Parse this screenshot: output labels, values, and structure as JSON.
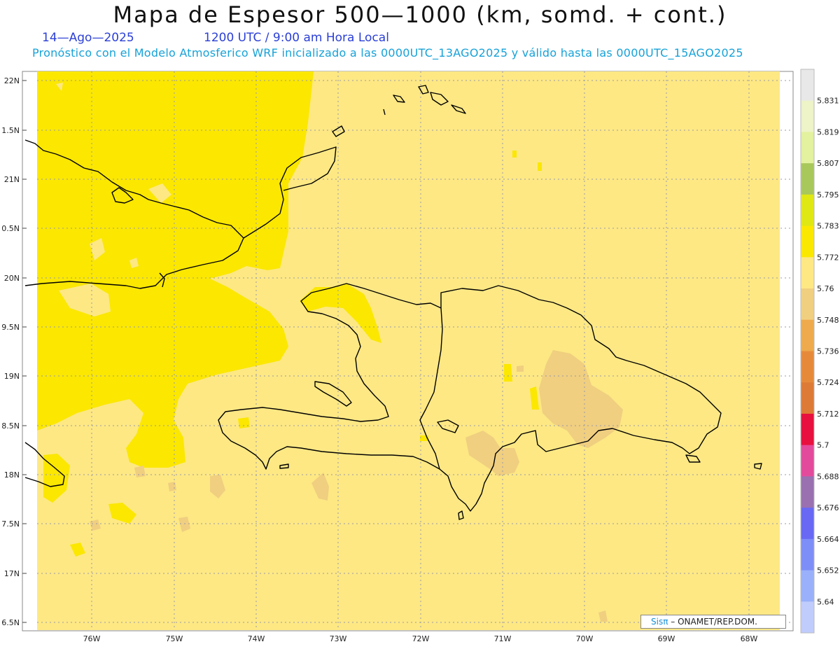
{
  "header": {
    "title": "Mapa de Espesor 500—1000 (km, somd. + cont.)",
    "date": "14—Ago—2025",
    "time": "1200 UTC / 9:00 am Hora Local",
    "forecast_note": "Pronóstico con el Modelo Atmosferico WRF inicializado a las 0000UTC_13AGO2025 y válido hasta las  0000UTC_15AGO2025"
  },
  "map": {
    "lat_labels": [
      "22N",
      "1.5N",
      "21N",
      "0.5N",
      "20N",
      "9.5N",
      "19N",
      "8.5N",
      "18N",
      "7.5N",
      "17N",
      "6.5N"
    ],
    "lon_labels": [
      "76W",
      "75W",
      "74W",
      "73W",
      "72W",
      "71W",
      "70W",
      "69W",
      "68W"
    ],
    "field_colors": {
      "dominant": "#fde884",
      "higher": "#fbe700",
      "lower": "#f0cf80",
      "coast": "#000000",
      "grid": "#9a9aa8"
    }
  },
  "colorbar": {
    "labels": [
      "5.831",
      "5.819",
      "5.807",
      "5.795",
      "5.783",
      "5.772",
      "5.76",
      "5.748",
      "5.736",
      "5.724",
      "5.712",
      "5.7",
      "5.688",
      "5.676",
      "5.664",
      "5.652",
      "5.64"
    ],
    "colors": [
      "#e8e8e8",
      "#eef3c8",
      "#e2f29e",
      "#a9c85c",
      "#e0e814",
      "#fbe800",
      "#fde884",
      "#f0cf80",
      "#eeaa4c",
      "#e68a3a",
      "#dd7a36",
      "#e8103e",
      "#e44a9c",
      "#9a70b0",
      "#6868f4",
      "#7e8ef8",
      "#9ab0fa",
      "#c0ccfc"
    ]
  },
  "credit": {
    "brand": "Sisπ",
    "text": "– ONAMET/REP.DOM."
  }
}
